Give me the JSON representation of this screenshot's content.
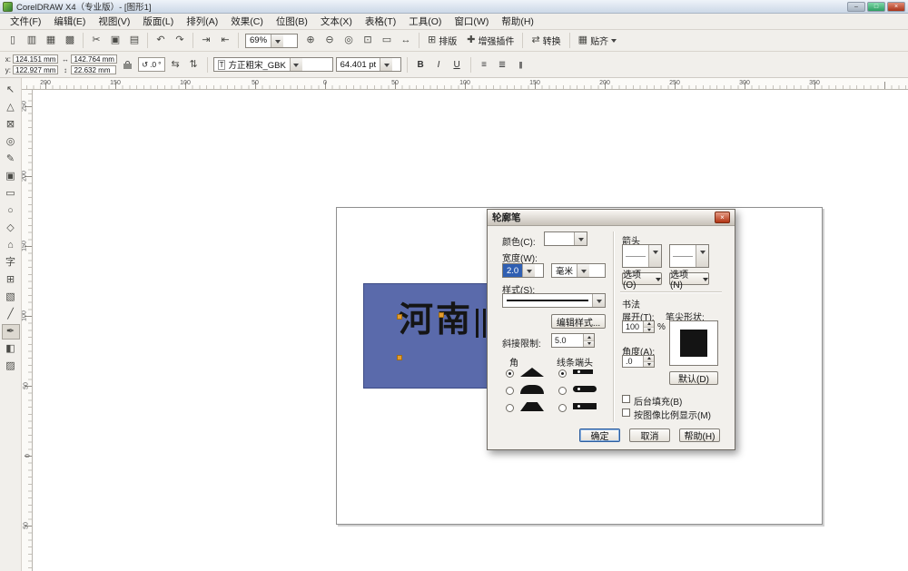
{
  "window": {
    "title": "CorelDRAW X4（专业版）- [图形1]",
    "minimize_glyph": "–",
    "maximize_glyph": "□",
    "close_glyph": "×"
  },
  "menubar": {
    "items": [
      {
        "label": "文件(F)"
      },
      {
        "label": "编辑(E)"
      },
      {
        "label": "视图(V)"
      },
      {
        "label": "版面(L)"
      },
      {
        "label": "排列(A)"
      },
      {
        "label": "效果(C)"
      },
      {
        "label": "位图(B)"
      },
      {
        "label": "文本(X)"
      },
      {
        "label": "表格(T)"
      },
      {
        "label": "工具(O)"
      },
      {
        "label": "窗口(W)"
      },
      {
        "label": "帮助(H)"
      }
    ]
  },
  "toolbar": {
    "zoom_value": "69%",
    "icons_left": [
      {
        "name": "new",
        "glyph": "▯"
      },
      {
        "name": "open",
        "glyph": "▥"
      },
      {
        "name": "save",
        "glyph": "▦"
      },
      {
        "name": "print",
        "glyph": "▩"
      },
      {
        "name": "cut",
        "glyph": "✂"
      },
      {
        "name": "copy",
        "glyph": "▣"
      },
      {
        "name": "paste",
        "glyph": "▤"
      },
      {
        "name": "undo",
        "glyph": "↶"
      },
      {
        "name": "redo",
        "glyph": "↷"
      },
      {
        "name": "import",
        "glyph": "⇥"
      },
      {
        "name": "export",
        "glyph": "⇤"
      }
    ],
    "zoom_icons": [
      {
        "name": "zoom-in",
        "glyph": "⊕"
      },
      {
        "name": "zoom-out",
        "glyph": "⊖"
      },
      {
        "name": "zoom-selected",
        "glyph": "◎"
      },
      {
        "name": "zoom-all",
        "glyph": "⊡"
      },
      {
        "name": "zoom-page",
        "glyph": "▭"
      },
      {
        "name": "zoom-width",
        "glyph": "↔"
      }
    ],
    "labeled_buttons": [
      {
        "glyph": "⊞",
        "label": "排版"
      },
      {
        "glyph": "✚",
        "label": "增强插件"
      },
      {
        "glyph": "⇄",
        "label": "转换"
      },
      {
        "glyph": "▦",
        "label": "贴齐"
      }
    ]
  },
  "property_bar": {
    "x_label": "x:",
    "x_value": "124.151 mm",
    "y_label": "y:",
    "y_value": "122.927 mm",
    "size_h_icon": "↔",
    "width_value": "142.764 mm",
    "size_v_icon": "↕",
    "height_value": "22.632 mm",
    "rotation_icon": "↺",
    "rotation_value": ".0",
    "rotation_unit": "°",
    "mirror_h_icon": "⇆",
    "mirror_v_icon": "⇅",
    "font_list_icon": "T",
    "font_name": "方正粗宋_GBK",
    "font_size": "64.401 pt",
    "bold_label": "B",
    "italic_label": "I",
    "underline_label": "U",
    "align_icon": "≡",
    "paragraph_icon": "≣",
    "columns_icon": "|||"
  },
  "rulers": {
    "h": [
      "200",
      "150",
      "100",
      "50",
      "0",
      "50",
      "100",
      "150",
      "200",
      "250",
      "300",
      "350"
    ],
    "v": [
      "250",
      "200",
      "150",
      "100",
      "50",
      "0",
      "50"
    ]
  },
  "toolbox": {
    "tools": [
      {
        "name": "pick",
        "glyph": "↖"
      },
      {
        "name": "shape",
        "glyph": "△"
      },
      {
        "name": "crop",
        "glyph": "⊠"
      },
      {
        "name": "zoom",
        "glyph": "◎"
      },
      {
        "name": "freehand",
        "glyph": "✎"
      },
      {
        "name": "smart-fill",
        "glyph": "▣"
      },
      {
        "name": "rectangle",
        "glyph": "▭"
      },
      {
        "name": "ellipse",
        "glyph": "○"
      },
      {
        "name": "polygon",
        "glyph": "◇"
      },
      {
        "name": "basic-shapes",
        "glyph": "⌂"
      },
      {
        "name": "text",
        "glyph": "字"
      },
      {
        "name": "table",
        "glyph": "⊞"
      },
      {
        "name": "blend",
        "glyph": "▧"
      },
      {
        "name": "eyedropper",
        "glyph": "╱"
      },
      {
        "name": "outline-pen",
        "glyph": "✒"
      },
      {
        "name": "fill",
        "glyph": "◧"
      },
      {
        "name": "interactive-fill",
        "glyph": "▨"
      }
    ]
  },
  "canvas": {
    "text": "河南",
    "rect_color": "#5a6aab"
  },
  "dialog": {
    "title": "轮廓笔",
    "close_glyph": "×",
    "color": {
      "label": "颜色(C):"
    },
    "width": {
      "label": "宽度(W):",
      "value": "2.0",
      "unit": "毫米"
    },
    "style": {
      "label": "样式(S):"
    },
    "edit_style": "编辑样式...",
    "miter": {
      "label": "斜接限制:",
      "value": "5.0"
    },
    "corners_label": "角",
    "line_caps_label": "线条端头",
    "arrows": {
      "label": "箭头",
      "options_left": "选项(O)",
      "options_right": "选项(N)"
    },
    "calligraphy": {
      "label": "书法",
      "stretch_label": "展开(T):",
      "stretch_value": "100",
      "stretch_unit": "%",
      "angle_label": "角度(A):",
      "angle_value": ".0",
      "nib_label": "笔尖形状:",
      "default_button": "默认(D)"
    },
    "behind_fill_label": "后台填充(B)",
    "scale_with_image_label": "按图像比例显示(M)",
    "buttons": {
      "ok": "确定",
      "cancel": "取消",
      "help": "帮助(H)"
    }
  }
}
